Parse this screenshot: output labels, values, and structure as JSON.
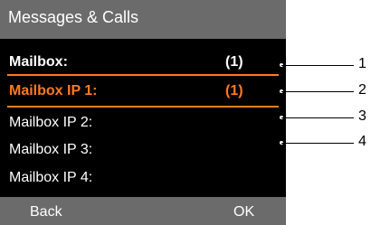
{
  "screen": {
    "title": "Messages & Calls",
    "items": [
      {
        "label": "Mailbox:",
        "count": "(1)"
      },
      {
        "label": "Mailbox IP 1:",
        "count": "(1)"
      },
      {
        "label": "Mailbox  IP 2:",
        "count": ""
      },
      {
        "label": "Mailbox  IP 3:",
        "count": ""
      },
      {
        "label": "Mailbox  IP 4:",
        "count": ""
      }
    ],
    "scroll_indicator": "down-arrow-icon",
    "softkeys": {
      "left": "Back",
      "right": "OK"
    }
  },
  "callouts": [
    "1",
    "2",
    "3",
    "4"
  ],
  "colors": {
    "title_bar": "#6b6b6b",
    "screen_bg": "#000000",
    "highlight": "#ff7a1f",
    "text": "#ffffff"
  }
}
